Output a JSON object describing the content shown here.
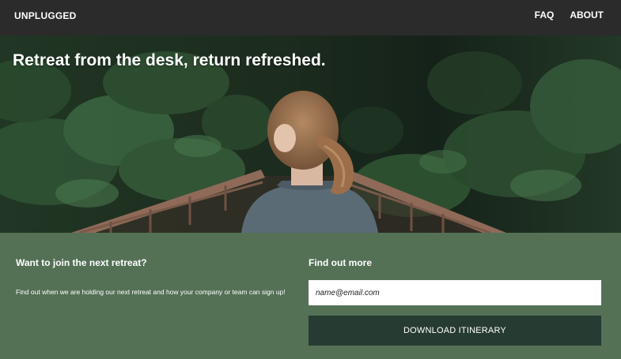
{
  "nav": {
    "brand": "UNPLUGGED",
    "links": [
      {
        "label": "FAQ"
      },
      {
        "label": "ABOUT"
      }
    ]
  },
  "hero": {
    "headline": "Retreat from the desk, return refreshed."
  },
  "signup": {
    "left_title": "Want to join the next retreat?",
    "left_text": "Find out when we are holding our next retreat and how your company or team can sign up!",
    "right_title": "Find out more",
    "email_placeholder": "name@email.com",
    "download_label": "DOWNLOAD ITINERARY"
  },
  "colors": {
    "nav_bg": "#2b2b2b",
    "section_bg": "#547156",
    "button_bg": "#263b32",
    "text": "#ffffff"
  }
}
